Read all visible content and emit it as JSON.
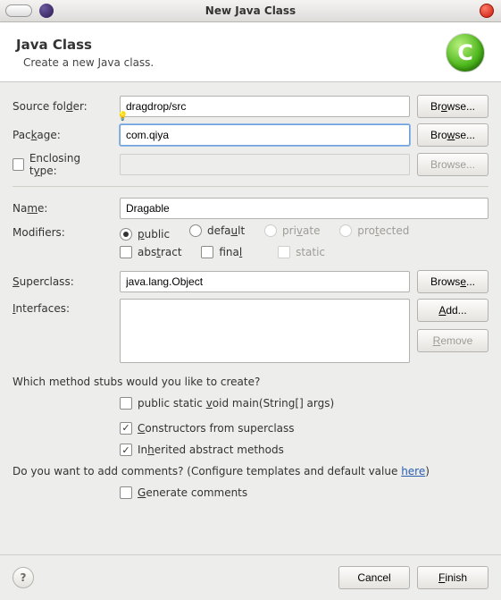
{
  "window": {
    "title": "New Java Class"
  },
  "header": {
    "title": "Java Class",
    "subtitle": "Create a new Java class."
  },
  "labels": {
    "source_folder_pre": "Source fol",
    "source_folder_u": "d",
    "source_folder_post": "er:",
    "package_pre": "Pac",
    "package_u": "k",
    "package_post": "age:",
    "enclosing_pre": "Enclosing t",
    "enclosing_u": "y",
    "enclosing_post": "pe:",
    "name_pre": "Na",
    "name_u": "m",
    "name_post": "e:",
    "modifiers": "Modifiers:",
    "superclass_pre": "",
    "superclass_u": "S",
    "superclass_post": "uperclass:",
    "interfaces_pre": "",
    "interfaces_u": "I",
    "interfaces_post": "nterfaces:",
    "stubs_question": "Which method stubs would you like to create?",
    "comments_q_pre": "Do you want to add comments? (Configure templates and default value ",
    "comments_q_link": "here",
    "comments_q_post": ")"
  },
  "values": {
    "source_folder": "dragdrop/src",
    "package": "com.qiya",
    "enclosing_type": "",
    "name": "Dragable",
    "superclass": "java.lang.Object"
  },
  "modifiers": {
    "public_pre": "",
    "public_u": "p",
    "public_post": "ublic",
    "default_pre": "defa",
    "default_u": "u",
    "default_post": "lt",
    "private_pre": "pri",
    "private_u": "v",
    "private_post": "ate",
    "protected_pre": "pro",
    "protected_u": "t",
    "protected_post": "ected",
    "abstract_pre": "abs",
    "abstract_u": "t",
    "abstract_post": "ract",
    "final_pre": "fina",
    "final_u": "l",
    "final_post": "",
    "static": "static"
  },
  "stubs": {
    "main_pre": "public static ",
    "main_u": "v",
    "main_post": "oid main(String[] args)",
    "constructors_pre": "",
    "constructors_u": "C",
    "constructors_post": "onstructors from superclass",
    "inherited_pre": "In",
    "inherited_u": "h",
    "inherited_post": "erited abstract methods",
    "generate_pre": "",
    "generate_u": "G",
    "generate_post": "enerate comments"
  },
  "buttons": {
    "browse_pre": "Br",
    "browse_u": "o",
    "browse_post": "wse...",
    "browse2_pre": "Bro",
    "browse2_u": "w",
    "browse2_post": "se...",
    "browse3": "Browse...",
    "browse4_pre": "Brows",
    "browse4_u": "e",
    "browse4_post": "...",
    "add_pre": "",
    "add_u": "A",
    "add_post": "dd...",
    "remove_pre": "",
    "remove_u": "R",
    "remove_post": "emove",
    "cancel": "Cancel",
    "finish_pre": "",
    "finish_u": "F",
    "finish_post": "inish"
  }
}
